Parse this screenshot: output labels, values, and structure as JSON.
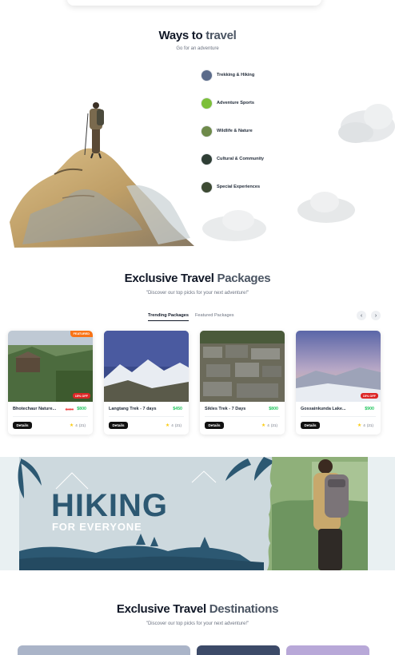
{
  "ways": {
    "title_main": "Ways to",
    "title_accent": "travel",
    "subtitle": "Go for an adventure",
    "items": [
      {
        "label": "Trekking & Hiking",
        "color": "#5b6b8a"
      },
      {
        "label": "Adventure Sports",
        "color": "#7cbf3a"
      },
      {
        "label": "Wildlife & Nature",
        "color": "#6e8a4a"
      },
      {
        "label": "Cultural & Community",
        "color": "#2f3e35"
      },
      {
        "label": "Special Experiences",
        "color": "#3d4a33"
      }
    ]
  },
  "packages": {
    "title_main": "Exclusive Travel",
    "title_accent": "Packages",
    "subtitle": "\"Discover our top picks for your next adventure!\"",
    "tabs": [
      "Trending Packages",
      "Featured Packages"
    ],
    "active_tab": "Trending Packages",
    "prev_icon": "chevron-left-icon",
    "next_icon": "chevron-right-icon",
    "cards": [
      {
        "name": "Bhotechaur Nature...",
        "old_price": "$800",
        "price": "$800",
        "details_label": "Details",
        "rating": "4",
        "reviews": "(21)",
        "featured_label": "FEATURED",
        "discount_label": "15% OFF"
      },
      {
        "name": "Langtang Trek - 7 days",
        "old_price": "",
        "price": "$450",
        "details_label": "Details",
        "rating": "4",
        "reviews": "(21)",
        "featured_label": "",
        "discount_label": ""
      },
      {
        "name": "Sikles Trek - 7 Days",
        "old_price": "",
        "price": "$800",
        "details_label": "Details",
        "rating": "4",
        "reviews": "(21)",
        "featured_label": "",
        "discount_label": ""
      },
      {
        "name": "Gossainkunda Lake...",
        "old_price": "",
        "price": "$900",
        "details_label": "Details",
        "rating": "4",
        "reviews": "(21)",
        "featured_label": "",
        "discount_label": "15% OFF"
      }
    ]
  },
  "banner": {
    "headline": "HIKING",
    "tagline": "FOR EVERYONE",
    "bg_color": "#cdd9de",
    "text_color": "#2c5872"
  },
  "destinations": {
    "title_main": "Exclusive Travel",
    "title_accent": "Destinations",
    "subtitle": "\"Discover our top picks for your next adventure!\""
  }
}
